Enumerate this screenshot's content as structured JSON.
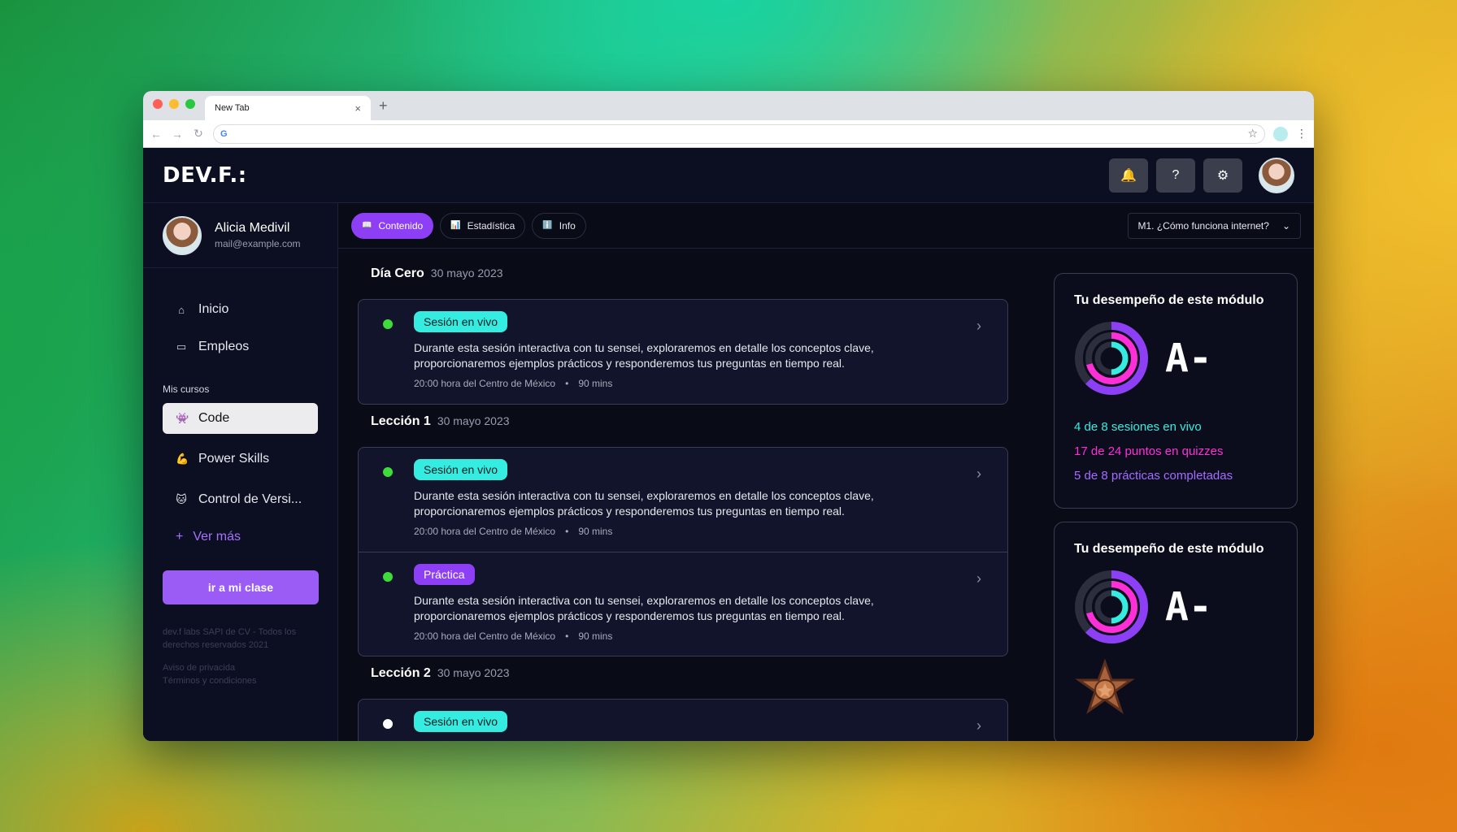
{
  "browser": {
    "tab_title": "New Tab",
    "tab_close": "×",
    "new_tab": "+",
    "address_value": "",
    "back": "←",
    "forward": "→",
    "reload": "↻",
    "google_icon": "G",
    "star": "☆",
    "menu": "⋮"
  },
  "header": {
    "logo": "DEV.F.:",
    "actions": [
      {
        "name": "notifications",
        "glyph": "🔔"
      },
      {
        "name": "help",
        "glyph": "?"
      },
      {
        "name": "settings",
        "glyph": "⚙"
      }
    ]
  },
  "user": {
    "name": "Alicia Medivil",
    "email": "mail@example.com"
  },
  "nav": {
    "items": [
      {
        "label": "Inicio",
        "icon": "⌂"
      },
      {
        "label": "Empleos",
        "icon": "▭"
      }
    ],
    "section_label": "Mis cursos",
    "courses": [
      {
        "label": "Code",
        "emoji": "👾"
      },
      {
        "label": "Power Skills",
        "emoji": "💪"
      },
      {
        "label": "Control de Versi...",
        "emoji": "🐱"
      }
    ],
    "more": "Ver más",
    "more_icon": "+",
    "cta": "ir a mi clase",
    "legal_1": "dev.f labs SAPI de CV - Todos los derechos reservados 2021",
    "legal_2a": "Aviso de privacida",
    "legal_2b": "Términos y condiciones"
  },
  "tabs": [
    {
      "label": "Contenido",
      "icon": "📖"
    },
    {
      "label": "Estadística",
      "icon": "📊"
    },
    {
      "label": "Info",
      "icon": "ℹ️"
    }
  ],
  "module_select": {
    "value": "M1. ¿Cómo funciona internet?",
    "chevron": "⌄"
  },
  "days": [
    {
      "title": "Día Cero",
      "date": "30 mayo 2023"
    },
    {
      "title": "Lección 1",
      "date": "30 mayo 2023"
    },
    {
      "title": "Lección 2",
      "date": "30 mayo 2023"
    }
  ],
  "session": {
    "live": "Sesión en vivo",
    "practice": "Práctica",
    "description": "Durante esta sesión interactiva con tu sensei, exploraremos en detalle los conceptos clave, proporcionaremos ejemplos prácticos y responderemos tus preguntas en tiempo real.",
    "time": "20:00 hora del Centro de México",
    "sep": "•",
    "duration": "90 mins",
    "chevron": "›"
  },
  "performance": {
    "title": "Tu desempeño de este módulo",
    "grade": "A-",
    "stats": [
      "4 de 8 sesiones en vivo",
      "17 de 24 puntos en quizzes",
      "5 de 8 prácticas completadas"
    ],
    "rings": {
      "sessions": 0.5,
      "quizzes": 0.708,
      "practices": 0.625
    },
    "colors": {
      "sessions": "#34ede0",
      "quizzes": "#ff2fd8",
      "practices": "#8d3ff5"
    }
  }
}
